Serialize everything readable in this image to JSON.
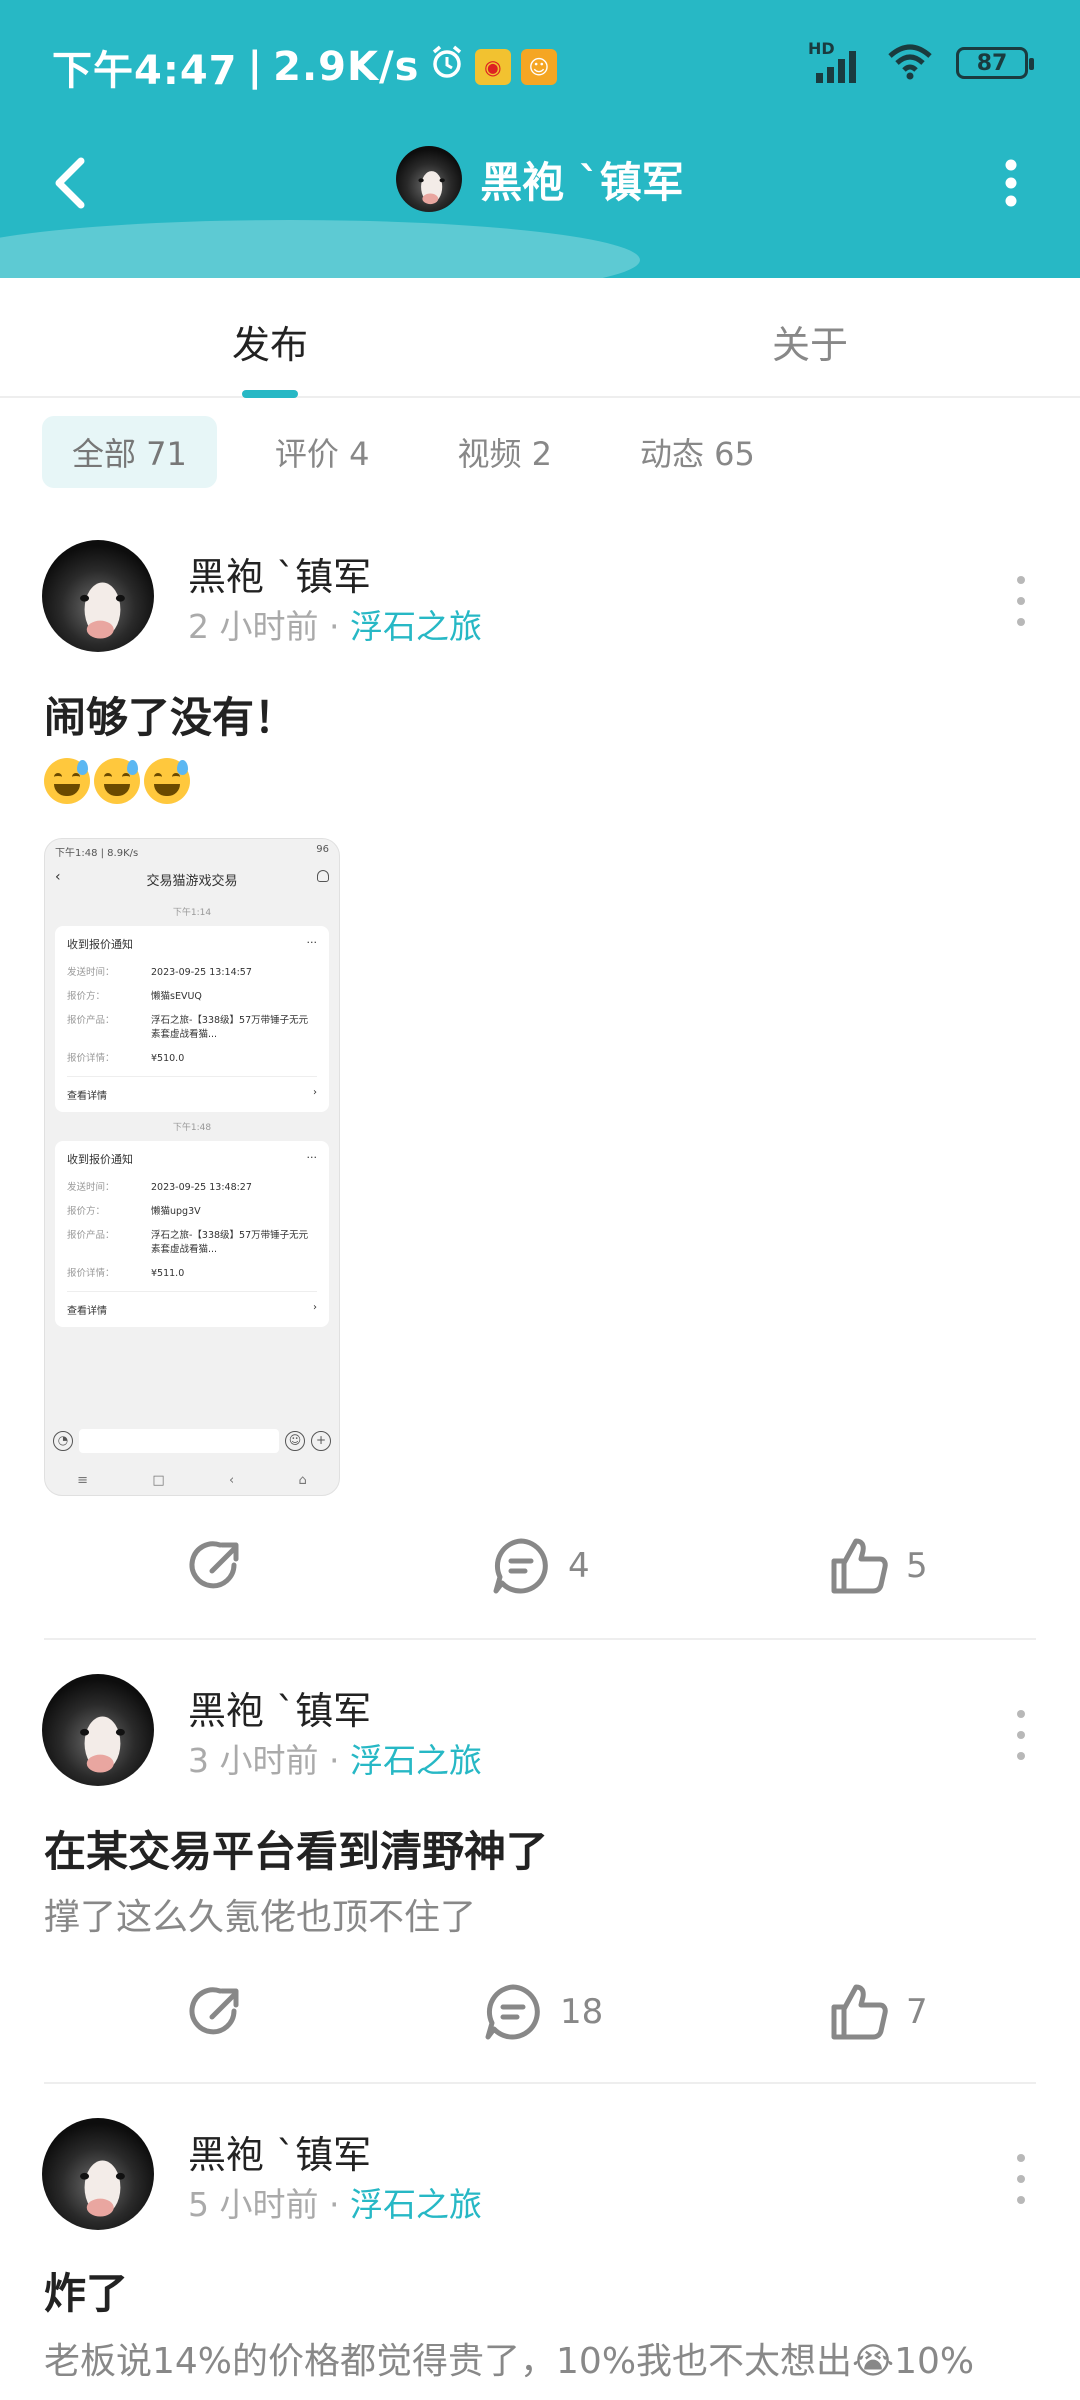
{
  "status_bar": {
    "time": "下午4:47",
    "speed": "2.9K/s",
    "network": "HD",
    "battery": "87"
  },
  "titlebar": {
    "title": "黑袍 `镇军"
  },
  "tabs": [
    {
      "label": "发布",
      "active": true
    },
    {
      "label": "关于",
      "active": false
    }
  ],
  "filters": [
    {
      "label": "全部 71",
      "active": true
    },
    {
      "label": "评价 4",
      "active": false
    },
    {
      "label": "视频 2",
      "active": false
    },
    {
      "label": "动态 65",
      "active": false
    }
  ],
  "posts": [
    {
      "author": "黑袍 `镇军",
      "time": "2 小时前",
      "separator": "·",
      "game": "浮石之旅",
      "title": "闹够了没有！",
      "body": "",
      "comments": "4",
      "likes": "5",
      "attachment": {
        "status_time": "下午1:48 | 8.9K/s",
        "status_batt": "96",
        "nav_title": "交易猫游戏交易",
        "messages": [
          {
            "time": "下午1:14",
            "card_title": "收到报价通知",
            "rows": [
              {
                "k": "发送时间：",
                "v": "2023-09-25 13:14:57"
              },
              {
                "k": "报价方：",
                "v": "懒猫sEVUQ"
              },
              {
                "k": "报价产品：",
                "v": "浮石之旅-【338级】57万带锤子无元素套虚战看猫..."
              },
              {
                "k": "报价详情：",
                "v": "¥510.0"
              }
            ],
            "link": "查看详情"
          },
          {
            "time": "下午1:48",
            "card_title": "收到报价通知",
            "rows": [
              {
                "k": "发送时间：",
                "v": "2023-09-25 13:48:27"
              },
              {
                "k": "报价方：",
                "v": "懒猫upg3V"
              },
              {
                "k": "报价产品：",
                "v": "浮石之旅-【338级】57万带锤子无元素套虚战看猫..."
              },
              {
                "k": "报价详情：",
                "v": "¥511.0"
              }
            ],
            "link": "查看详情"
          }
        ]
      }
    },
    {
      "author": "黑袍 `镇军",
      "time": "3 小时前",
      "separator": "·",
      "game": "浮石之旅",
      "title": "在某交易平台看到清野神了",
      "body": "撑了这么久氪佬也顶不住了",
      "comments": "18",
      "likes": "7"
    },
    {
      "author": "黑袍 `镇军",
      "time": "5 小时前",
      "separator": "·",
      "game": "浮石之旅",
      "title": "炸了",
      "body": "老板说14%的价格都觉得贵了，10%我也不太想出😭10%",
      "comments": "",
      "likes": ""
    }
  ],
  "colors": {
    "accent": "#27b8c5",
    "header_bg": "#27b8c5",
    "muted_text": "#888888"
  }
}
